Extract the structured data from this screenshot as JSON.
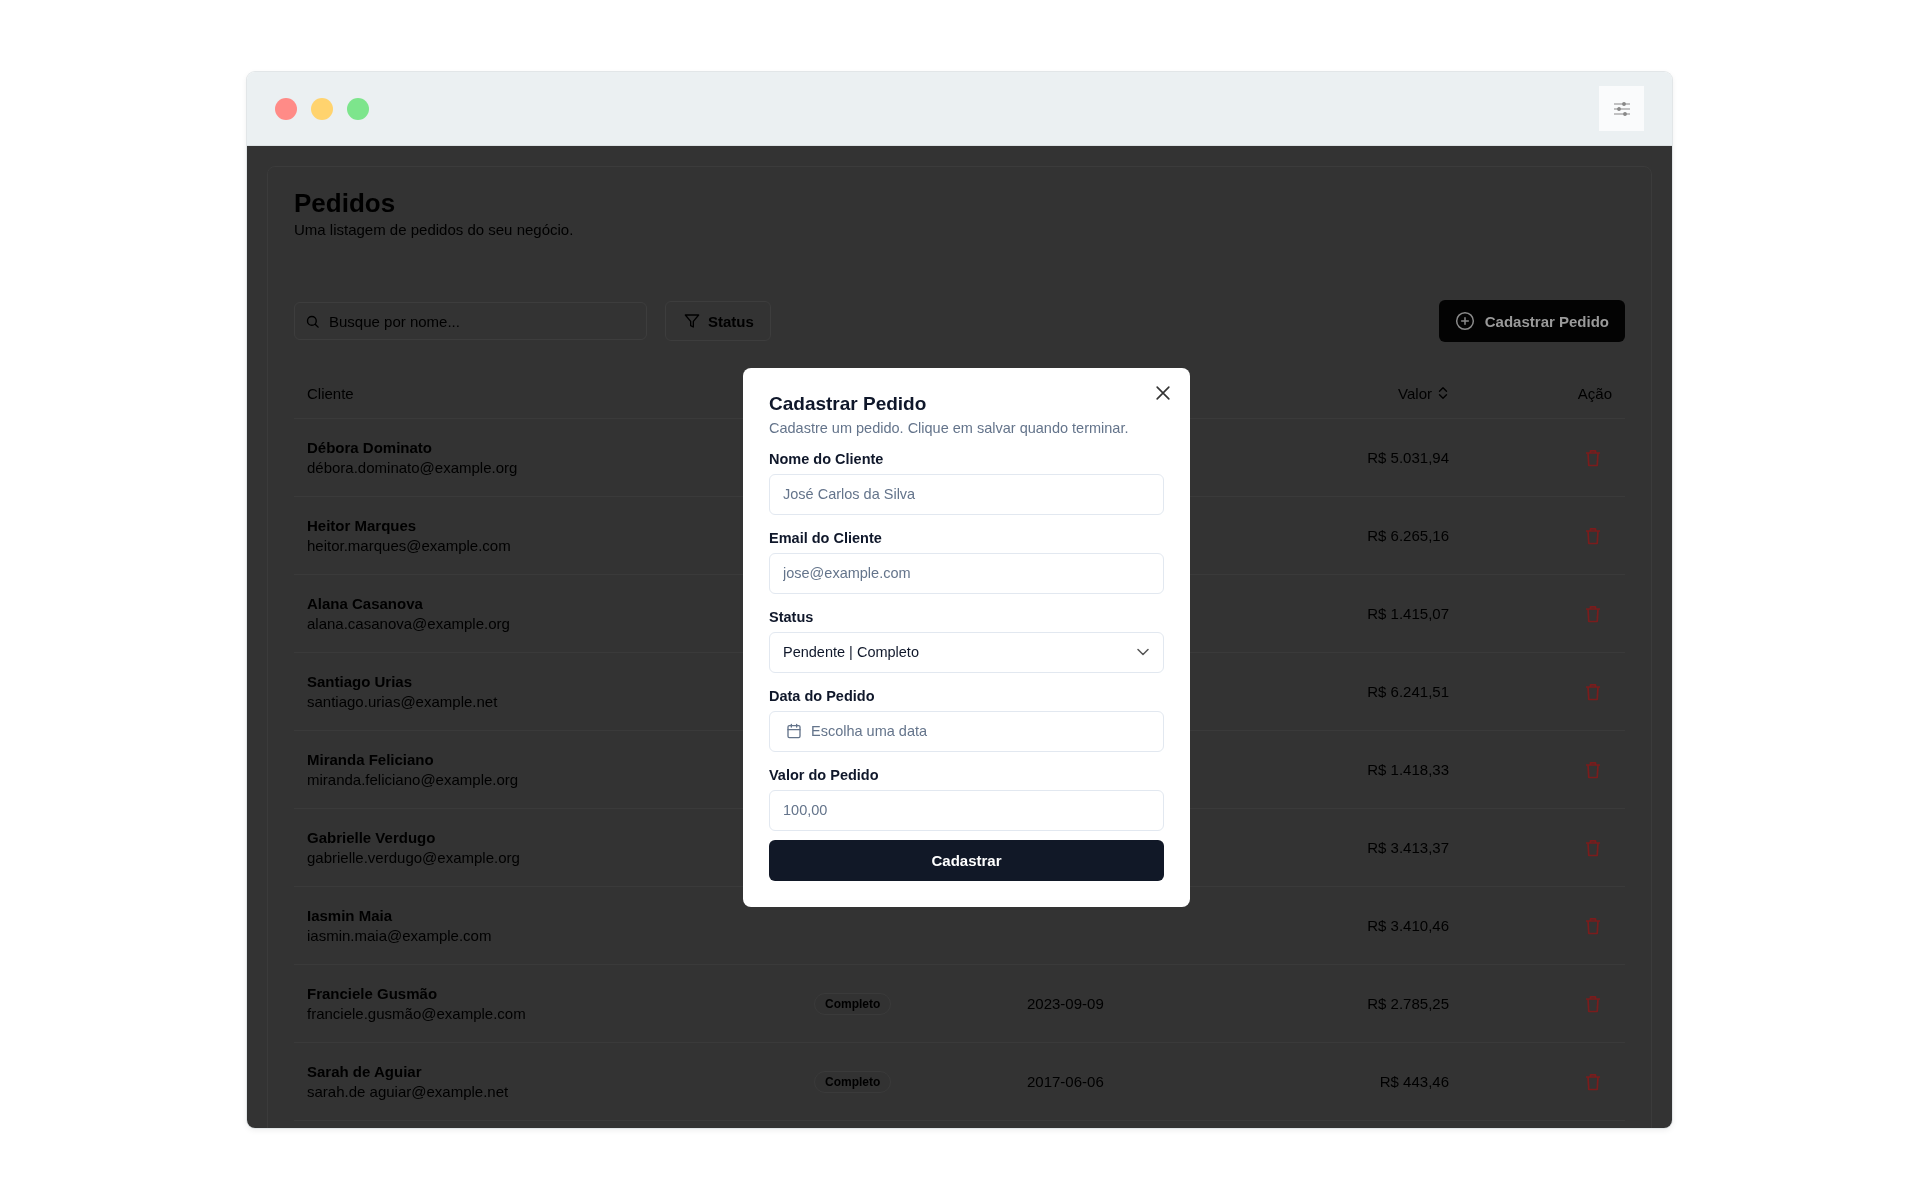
{
  "window": {
    "controls": [
      {
        "color": "#ff8b87"
      },
      {
        "color": "#ffd36e"
      },
      {
        "color": "#7de58c"
      }
    ]
  },
  "page": {
    "title": "Pedidos",
    "subtitle": "Uma listagem de pedidos do seu negócio.",
    "search": {
      "placeholder": "Busque por nome..."
    },
    "filter_button": "Status",
    "add_button": "Cadastrar Pedido"
  },
  "table": {
    "columns": {
      "client": "Cliente",
      "value": "Valor",
      "action": "Ação"
    },
    "rows": [
      {
        "name": "Débora Dominato",
        "email": "débora.dominato@example.org",
        "value": "R$ 5.031,94"
      },
      {
        "name": "Heitor Marques",
        "email": "heitor.marques@example.com",
        "value": "R$ 6.265,16"
      },
      {
        "name": "Alana Casanova",
        "email": "alana.casanova@example.org",
        "value": "R$ 1.415,07"
      },
      {
        "name": "Santiago Urias",
        "email": "santiago.urias@example.net",
        "value": "R$ 6.241,51"
      },
      {
        "name": "Miranda Feliciano",
        "email": "miranda.feliciano@example.org",
        "value": "R$ 1.418,33"
      },
      {
        "name": "Gabrielle Verdugo",
        "email": "gabrielle.verdugo@example.org",
        "value": "R$ 3.413,37"
      },
      {
        "name": "Iasmin Maia",
        "email": "iasmin.maia@example.com",
        "value": "R$ 3.410,46"
      },
      {
        "name": "Franciele Gusmão",
        "email": "franciele.gusmão@example.com",
        "status": "Completo",
        "date": "2023-09-09",
        "value": "R$ 2.785,25"
      },
      {
        "name": "Sarah de Aguiar",
        "email": "sarah.de aguiar@example.net",
        "status": "Completo",
        "date": "2017-06-06",
        "value": "R$ 443,46"
      }
    ]
  },
  "modal": {
    "title": "Cadastrar Pedido",
    "description": "Cadastre um pedido. Clique em salvar quando terminar.",
    "fields": [
      {
        "kind": "text",
        "label": "Nome do Cliente",
        "placeholder": "José Carlos da Silva"
      },
      {
        "kind": "text",
        "label": "Email do Cliente",
        "placeholder": "jose@example.com"
      },
      {
        "kind": "select",
        "label": "Status",
        "value": "Pendente | Completo"
      },
      {
        "kind": "date",
        "label": "Data do Pedido",
        "placeholder": "Escolha uma data"
      },
      {
        "kind": "text",
        "label": "Valor do Pedido",
        "placeholder": "100,00"
      }
    ],
    "submit": "Cadastrar"
  }
}
